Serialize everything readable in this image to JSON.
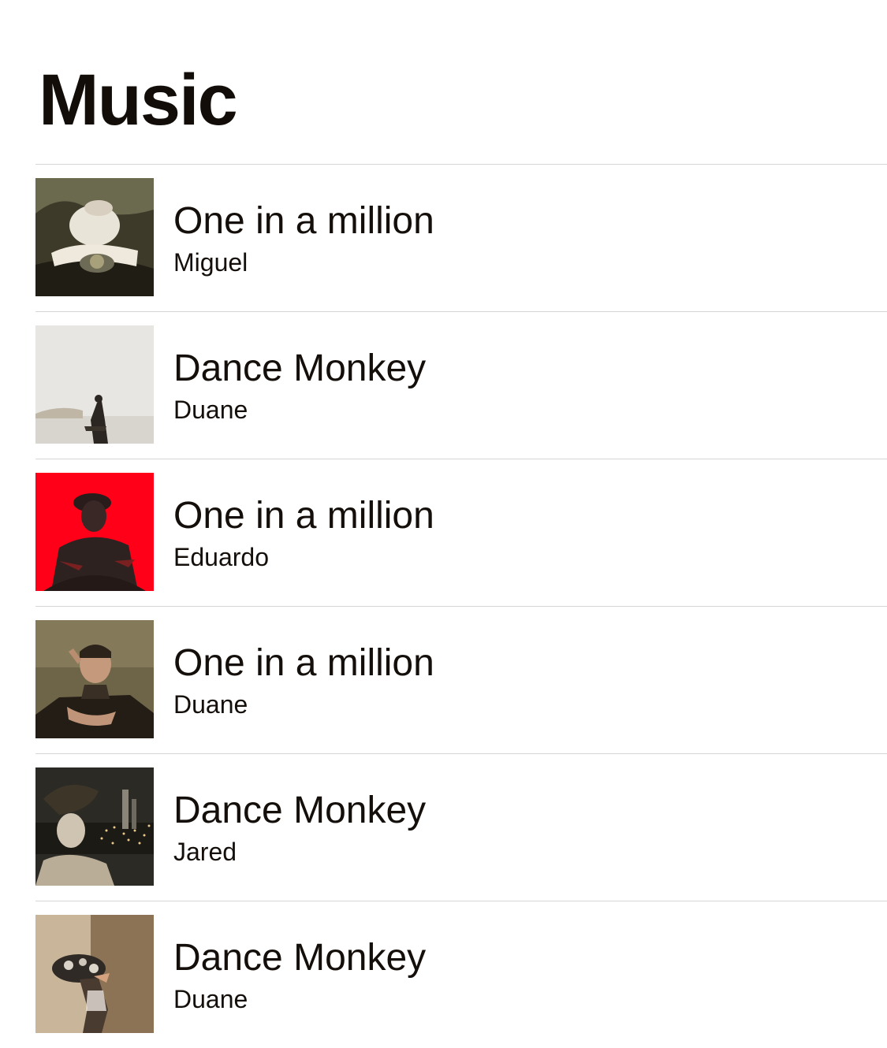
{
  "header": {
    "title": "Music"
  },
  "tracks": [
    {
      "title": "One in a million",
      "artist": "Miguel",
      "artwork": "person-lying-in-grass-artwork"
    },
    {
      "title": "Dance Monkey",
      "artist": "Duane",
      "artwork": "guitarist-on-beach-artwork"
    },
    {
      "title": "One in a million",
      "artist": "Eduardo",
      "artwork": "man-silhouette-red-artwork"
    },
    {
      "title": "One in a million",
      "artist": "Duane",
      "artwork": "man-portrait-artwork"
    },
    {
      "title": "Dance Monkey",
      "artist": "Jared",
      "artwork": "city-night-portrait-artwork"
    },
    {
      "title": "Dance Monkey",
      "artist": "Duane",
      "artwork": "woman-with-headpiece-artwork"
    }
  ],
  "colors": {
    "background": "#ffffff",
    "text": "#140f0a",
    "separator": "#d6d6d6"
  }
}
